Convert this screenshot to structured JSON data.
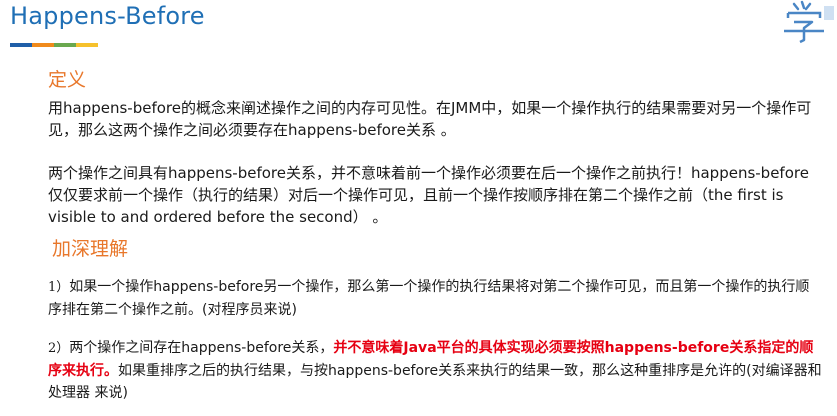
{
  "header": {
    "title": "Happens-Before",
    "stripe_colors": [
      "#1f5fa8",
      "#f08a1c",
      "#6aa84f",
      "#f6c12c"
    ],
    "logo_icon": "xuexi-logo-icon"
  },
  "section1": {
    "heading": "定义",
    "para1": "用happens-before的概念来阐述操作之间的内存可见性。在JMM中，如果一个操作执行的结果需要对另一个操作可见，那么这两个操作之间必须要存在happens-before关系 。",
    "para2": "两个操作之间具有happens-before关系，并不意味着前一个操作必须要在后一个操作之前执行！happens-before仅仅要求前一个操作（执行的结果）对后一个操作可见，且前一个操作按顺序排在第二个操作之前（the first is visible to and ordered before the second） 。"
  },
  "section2": {
    "heading": "加深理解",
    "item1_num": "1）",
    "item1_text": "如果一个操作happens-before另一个操作，那么第一个操作的执行结果将对第二个操作可见，而且第一个操作的执行顺序排在第二个操作之前。(对程序员来说)",
    "item2_num": "2）",
    "item2_text_a": "两个操作之间存在happens-before关系，",
    "item2_text_red": "并不意味着Java平台的具体实现必须要按照happens-before关系指定的顺序来执行。",
    "item2_text_b": "如果重排序之后的执行结果，与按happens-before关系来执行的结果一致，那么这种重排序是允许的(对编译器和处理器 来说)"
  }
}
